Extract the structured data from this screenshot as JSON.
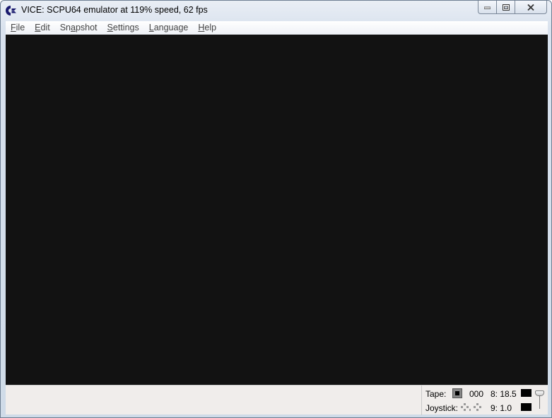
{
  "window": {
    "title": "VICE: SCPU64 emulator at 119% speed, 62 fps"
  },
  "menu": [
    {
      "pre": "",
      "mnemonic": "F",
      "post": "ile"
    },
    {
      "pre": "",
      "mnemonic": "E",
      "post": "dit"
    },
    {
      "pre": "Sn",
      "mnemonic": "a",
      "post": "pshot"
    },
    {
      "pre": "",
      "mnemonic": "S",
      "post": "ettings"
    },
    {
      "pre": "",
      "mnemonic": "L",
      "post": "anguage"
    },
    {
      "pre": "",
      "mnemonic": "H",
      "post": "elp"
    }
  ],
  "status": {
    "tape_label": "Tape:",
    "tape_counter": "000",
    "drive8_label": "8: 18.5",
    "joystick_label": "Joystick:",
    "drive9_label": "9: 1.0"
  },
  "colors": {
    "screen": "#121212",
    "status_bg": "#f0edeb"
  },
  "icons": {
    "app": "commodore-icon",
    "minimize": "minimize-icon",
    "maximize": "maximize-icon",
    "close": "close-icon"
  }
}
